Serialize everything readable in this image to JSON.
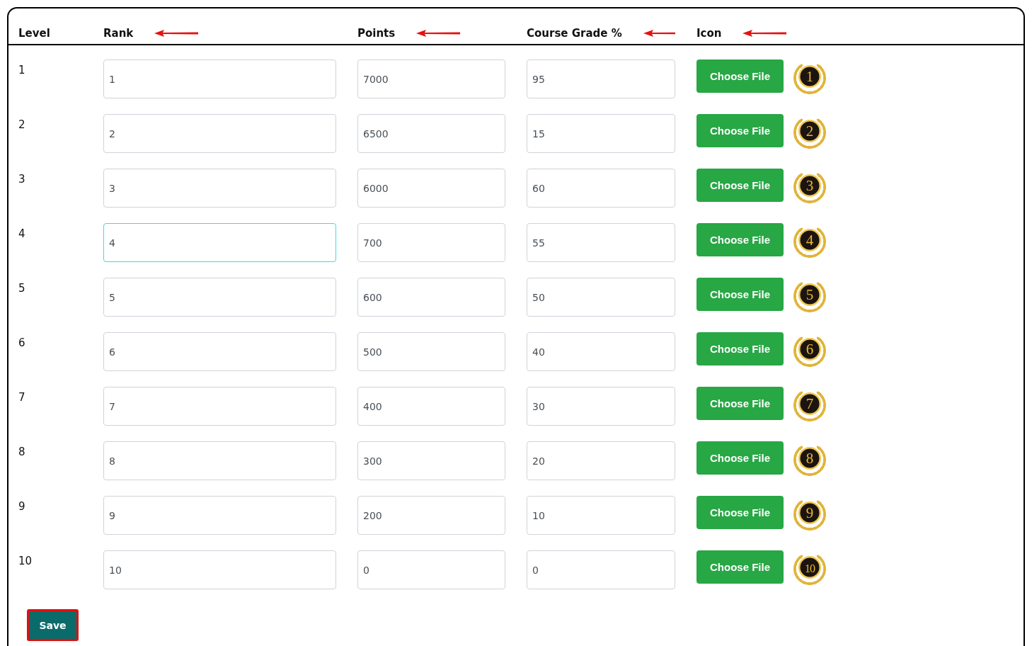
{
  "columns": [
    {
      "label": "Level",
      "arrow": false
    },
    {
      "label": "Rank",
      "arrow": true
    },
    {
      "label": "Points",
      "arrow": true
    },
    {
      "label": "Course Grade %",
      "arrow": true
    },
    {
      "label": "Icon",
      "arrow": true
    }
  ],
  "rows": [
    {
      "level": "1",
      "rank": "1",
      "points": "7000",
      "grade": "95",
      "button": "Choose File",
      "badge": "1",
      "focused": false
    },
    {
      "level": "2",
      "rank": "2",
      "points": "6500",
      "grade": "15",
      "button": "Choose File",
      "badge": "2",
      "focused": false
    },
    {
      "level": "3",
      "rank": "3",
      "points": "6000",
      "grade": "60",
      "button": "Choose File",
      "badge": "3",
      "focused": false
    },
    {
      "level": "4",
      "rank": "4",
      "points": "700",
      "grade": "55",
      "button": "Choose File",
      "badge": "4",
      "focused": true
    },
    {
      "level": "5",
      "rank": "5",
      "points": "600",
      "grade": "50",
      "button": "Choose File",
      "badge": "5",
      "focused": false
    },
    {
      "level": "6",
      "rank": "6",
      "points": "500",
      "grade": "40",
      "button": "Choose File",
      "badge": "6",
      "focused": false
    },
    {
      "level": "7",
      "rank": "7",
      "points": "400",
      "grade": "30",
      "button": "Choose File",
      "badge": "7",
      "focused": false
    },
    {
      "level": "8",
      "rank": "8",
      "points": "300",
      "grade": "20",
      "button": "Choose File",
      "badge": "8",
      "focused": false
    },
    {
      "level": "9",
      "rank": "9",
      "points": "200",
      "grade": "10",
      "button": "Choose File",
      "badge": "9",
      "focused": false
    },
    {
      "level": "10",
      "rank": "10",
      "points": "0",
      "grade": "0",
      "button": "Choose File",
      "badge": "10",
      "focused": false
    }
  ],
  "save_button": {
    "label": "Save",
    "outlined": true
  }
}
